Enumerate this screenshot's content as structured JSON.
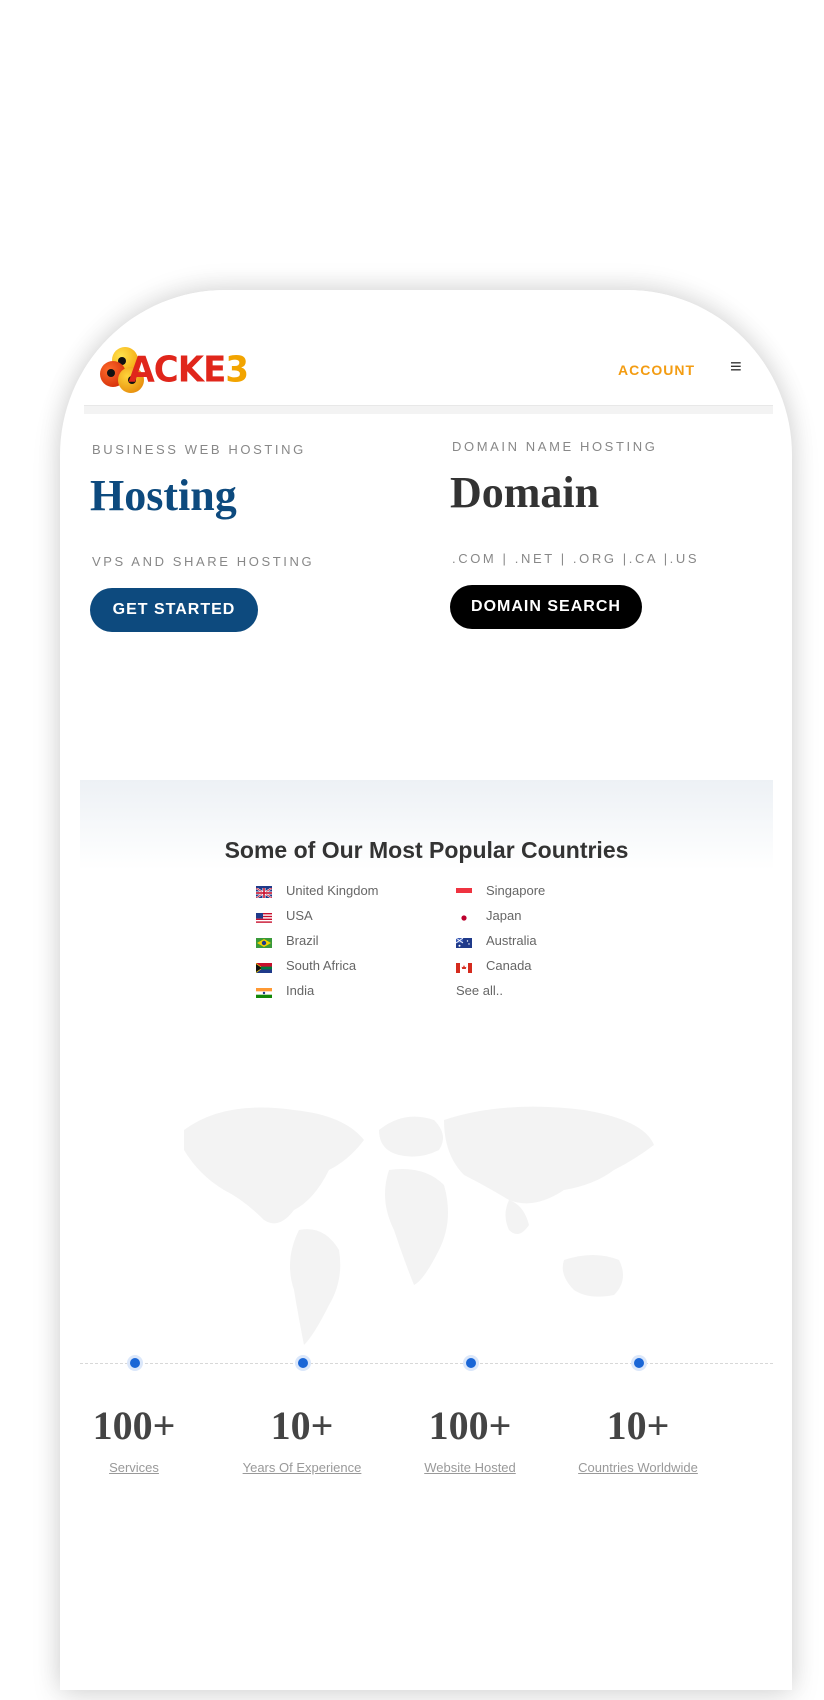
{
  "header": {
    "logo_text_main": "ACKE",
    "logo_text_tail": "3",
    "account_label": "ACCOUNT",
    "menu_glyph": "≡",
    "menu_icon": "hamburger-menu-icon"
  },
  "hero": {
    "hosting": {
      "eyebrow": "BUSINESS WEB HOSTING",
      "title": "Hosting",
      "subtitle": "VPS AND SHARE HOSTING",
      "button": "GET STARTED"
    },
    "domain": {
      "eyebrow": "DOMAIN NAME HOSTING",
      "title": "Domain",
      "subtitle": ".COM | .NET | .ORG |.CA |.US",
      "button": "DOMAIN SEARCH"
    }
  },
  "countries": {
    "title": "Some of Our Most Popular Countries",
    "left": [
      "United Kingdom",
      "USA",
      "Brazil",
      "South Africa",
      "India"
    ],
    "right": [
      "Singapore",
      "Japan",
      "Australia",
      "Canada"
    ],
    "see_all": "See all.."
  },
  "stats": [
    {
      "value": "100+",
      "label": "Services"
    },
    {
      "value": "10+",
      "label": "Years Of Experience"
    },
    {
      "value": "100+",
      "label": "Website Hosted"
    },
    {
      "value": "10+",
      "label": "Countries Worldwide"
    }
  ],
  "colors": {
    "accent_orange": "#f39c12",
    "hosting_blue": "#0d4a7e",
    "domain_black": "#000000",
    "timeline_dot": "#1a66d6"
  }
}
